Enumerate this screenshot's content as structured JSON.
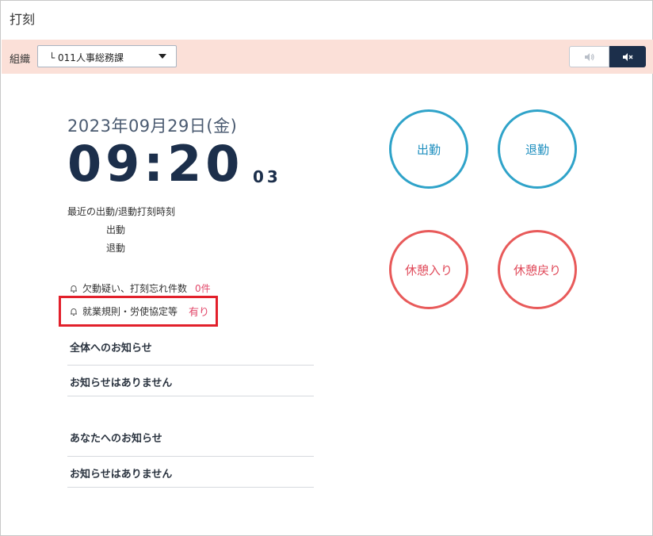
{
  "header": {
    "title": "打刻"
  },
  "org": {
    "label": "組織",
    "selected": "└ 011人事総務課"
  },
  "sound": {
    "on_icon": "volume-on-icon",
    "off_icon": "volume-mute-icon"
  },
  "clock": {
    "date": "2023年09月29日(金)",
    "time": "09:20",
    "seconds": "03"
  },
  "recent": {
    "title": "最近の出動/退動打刻時刻",
    "in_label": "出動",
    "out_label": "退動"
  },
  "alerts": [
    {
      "label": "欠動疑い、打刻忘れ件数",
      "value": "0件"
    },
    {
      "label": "就業規則・労使協定等",
      "value": "有り"
    }
  ],
  "notices": {
    "all_title": "全体へのお知らせ",
    "all_body": "お知らせはありません",
    "you_title": "あなたへのお知らせ",
    "you_body": "お知らせはありません"
  },
  "buttons": {
    "clock_in": "出勤",
    "clock_out": "退勤",
    "break_start": "休憩入り",
    "break_end": "休憩戻り"
  },
  "colors": {
    "navy": "#1c2f4b",
    "blue_accent": "#2fa3c9",
    "red_accent": "#e85a5a",
    "org_bar": "#fbe0d8",
    "highlight": "#e2202b"
  }
}
